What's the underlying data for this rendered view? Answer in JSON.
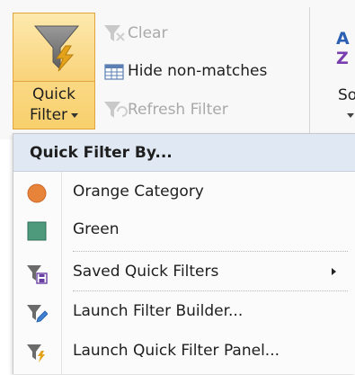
{
  "ribbon": {
    "quick_filter": {
      "label_line1": "Quick",
      "label_line2": "Filter",
      "icon": "funnel-lightning-icon"
    },
    "clear": {
      "label": "Clear",
      "icon": "funnel-clear-icon",
      "enabled": false
    },
    "hide_non_matches": {
      "label": "Hide non-matches",
      "icon": "table-filter-icon",
      "enabled": true
    },
    "refresh_filter": {
      "label": "Refresh Filter",
      "icon": "funnel-refresh-icon",
      "enabled": false
    },
    "sort": {
      "letter_a": "A",
      "letter_z": "Z",
      "label": "So",
      "icon": "sort-az-icon"
    }
  },
  "menu": {
    "header": "Quick Filter By...",
    "items": [
      {
        "label": "Orange Category",
        "icon": "orange-circle-icon",
        "color": "#e8833a"
      },
      {
        "label": "Green",
        "icon": "green-square-icon",
        "color": "#4e9a7d"
      },
      {
        "label": "Saved Quick Filters",
        "icon": "funnel-save-icon",
        "has_submenu": true
      },
      {
        "label": "Launch Filter Builder...",
        "icon": "funnel-pencil-icon"
      },
      {
        "label": "Launch Quick Filter Panel...",
        "icon": "funnel-lightning-icon"
      }
    ]
  },
  "colors": {
    "accent_highlight": "#f8cf6c",
    "accent_border": "#e2a53d",
    "menu_header_bg": "#dfe8f3",
    "funnel_gray": "#6b6b6b",
    "lightning_gold": "#e3a21a"
  }
}
